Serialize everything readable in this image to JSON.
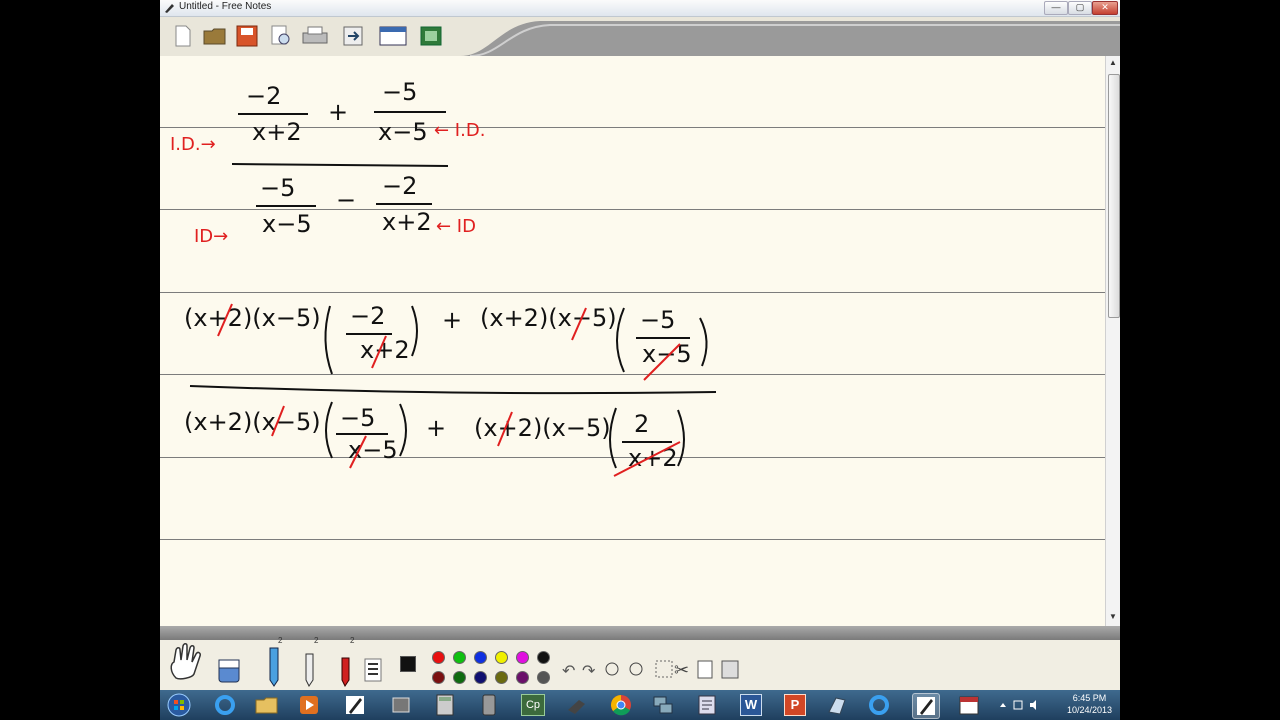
{
  "window": {
    "title": "Untitled - Free Notes",
    "min_label": "—",
    "max_label": "▢",
    "close_label": "✕"
  },
  "toolbar": {
    "buttons": [
      "new-note",
      "open",
      "save",
      "print-preview",
      "print",
      "export",
      "fullscreen",
      "screen-capture"
    ]
  },
  "notes": {
    "line1": {
      "num_left": "−2",
      "den_left": "x+2",
      "plus": "+",
      "num_right": "−5",
      "den_right": "x−5",
      "label_left": "I.D.→",
      "label_right": "← I.D."
    },
    "line2": {
      "num_left": "−5",
      "den_left": "x−5",
      "minus": "−",
      "num_right": "−2",
      "den_right": "x+2",
      "label_left": "ID→",
      "label_right": "← ID"
    },
    "numerator_work": "(x+2)(x−5)(−2 / x+2) + (x+2)(x−5)(−5 / x−5)",
    "denominator_work": "(x+2)(x−5)(−5 / x−5) + (x+2)(x−5)(2 / x+2)",
    "ink_colors": {
      "black": "#111111",
      "red": "#e02020"
    }
  },
  "toolpanel": {
    "pen_sizes": [
      "2",
      "2",
      "2"
    ],
    "colors_top": [
      "#e81010",
      "#10c010",
      "#1030e0",
      "#f0f000",
      "#e010e0",
      "#111111"
    ],
    "colors_bottom": [
      "#7a1010",
      "#0f6a0f",
      "#101070",
      "#6a6a10",
      "#6a106a",
      "#555555"
    ]
  },
  "taskbar": {
    "time": "6:45 PM",
    "date": "10/24/2013",
    "apps": [
      "start",
      "ie",
      "explorer",
      "media-player",
      "free-notes",
      "app",
      "calculator",
      "phone",
      "captivate",
      "tool",
      "chrome",
      "network",
      "document",
      "word",
      "powerpoint",
      "app2",
      "ie2",
      "free-notes-active",
      "calendar"
    ],
    "cp_label": "Cp",
    "word_label": "W",
    "ppt_label": "P"
  }
}
